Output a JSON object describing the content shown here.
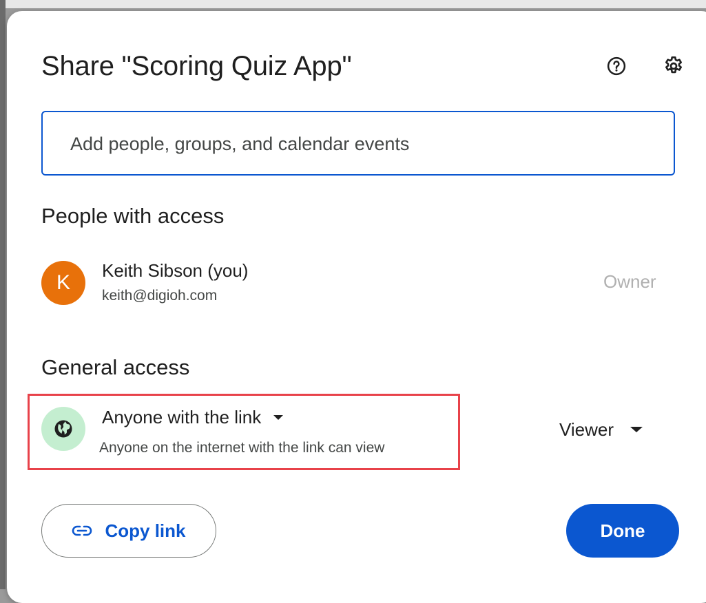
{
  "dialog": {
    "title": "Share \"Scoring Quiz App\"",
    "help_icon": "help-circle-icon",
    "settings_icon": "gear-icon"
  },
  "search": {
    "placeholder": "Add people, groups, and calendar events",
    "value": ""
  },
  "people_section": {
    "heading": "People with access",
    "people": [
      {
        "avatar_letter": "K",
        "avatar_color": "#e8710a",
        "name": "Keith Sibson (you)",
        "email": "keith@digioh.com",
        "role": "Owner"
      }
    ]
  },
  "general_access": {
    "heading": "General access",
    "icon": "globe-icon",
    "access_level": "Anyone with the link",
    "description": "Anyone on the internet with the link can view",
    "role": "Viewer"
  },
  "footer": {
    "copy_link_label": "Copy link",
    "copy_link_icon": "link-icon",
    "done_label": "Done"
  },
  "colors": {
    "accent": "#0b57d0",
    "highlight": "#e8424a",
    "globe_bg": "#c4eed0"
  }
}
